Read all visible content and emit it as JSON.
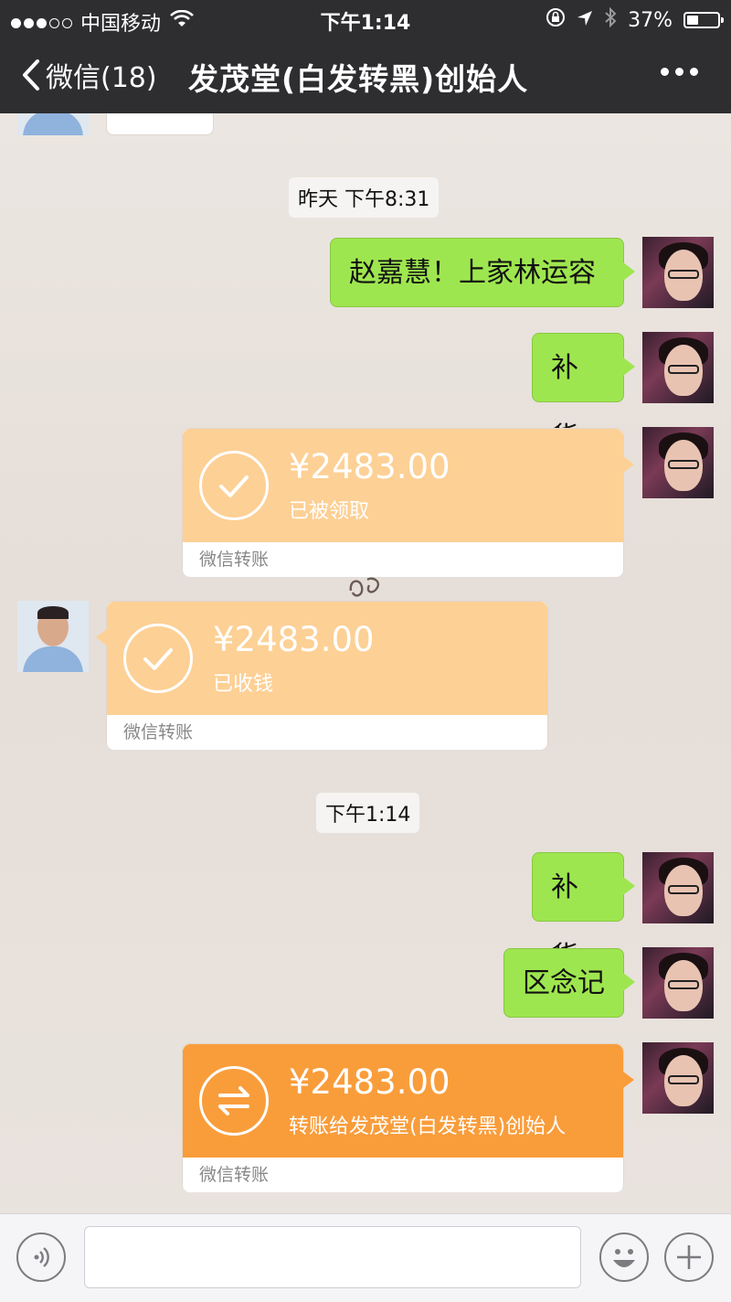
{
  "status_bar": {
    "carrier": "中国移动",
    "time": "下午1:14",
    "battery": "37%",
    "battery_level": 0.37,
    "signal_icons": [
      "signal-dots-icon",
      "wifi-icon",
      "rotation-lock-icon",
      "location-icon",
      "bluetooth-icon",
      "battery-icon"
    ]
  },
  "nav": {
    "back_label": "微信(18)",
    "title": "发茂堂(白发转黑)创始人",
    "more_icon": "more-icon"
  },
  "colors": {
    "my_bubble": "#9ee64f",
    "transfer_received": "#fdd095",
    "transfer_pending": "#f99d3b",
    "chat_bg": "#e9e3de",
    "bar_bg": "#2e2e31"
  },
  "messages": [
    {
      "type": "timestamp",
      "text": "昨天 下午8:31"
    },
    {
      "type": "text",
      "sender": "me",
      "text": "赵嘉慧！上家林运容"
    },
    {
      "type": "text",
      "sender": "me",
      "text": "补货"
    },
    {
      "type": "transfer",
      "sender": "me",
      "amount": "¥2483.00",
      "status": "已被领取",
      "footer": "微信转账",
      "icon": "check-icon"
    },
    {
      "type": "transfer",
      "sender": "other",
      "amount": "¥2483.00",
      "status": "已收钱",
      "footer": "微信转账",
      "icon": "check-icon"
    },
    {
      "type": "timestamp",
      "text": "下午1:14"
    },
    {
      "type": "text",
      "sender": "me",
      "text": "补货"
    },
    {
      "type": "text",
      "sender": "me",
      "text": "区念记"
    },
    {
      "type": "transfer",
      "sender": "me",
      "amount": "¥2483.00",
      "status": "转账给发茂堂(白发转黑)创始人",
      "footer": "微信转账",
      "icon": "transfer-arrows-icon"
    }
  ],
  "input_bar": {
    "voice_icon": "voice-icon",
    "emoji_icon": "emoji-icon",
    "plus_icon": "plus-icon",
    "value": ""
  }
}
